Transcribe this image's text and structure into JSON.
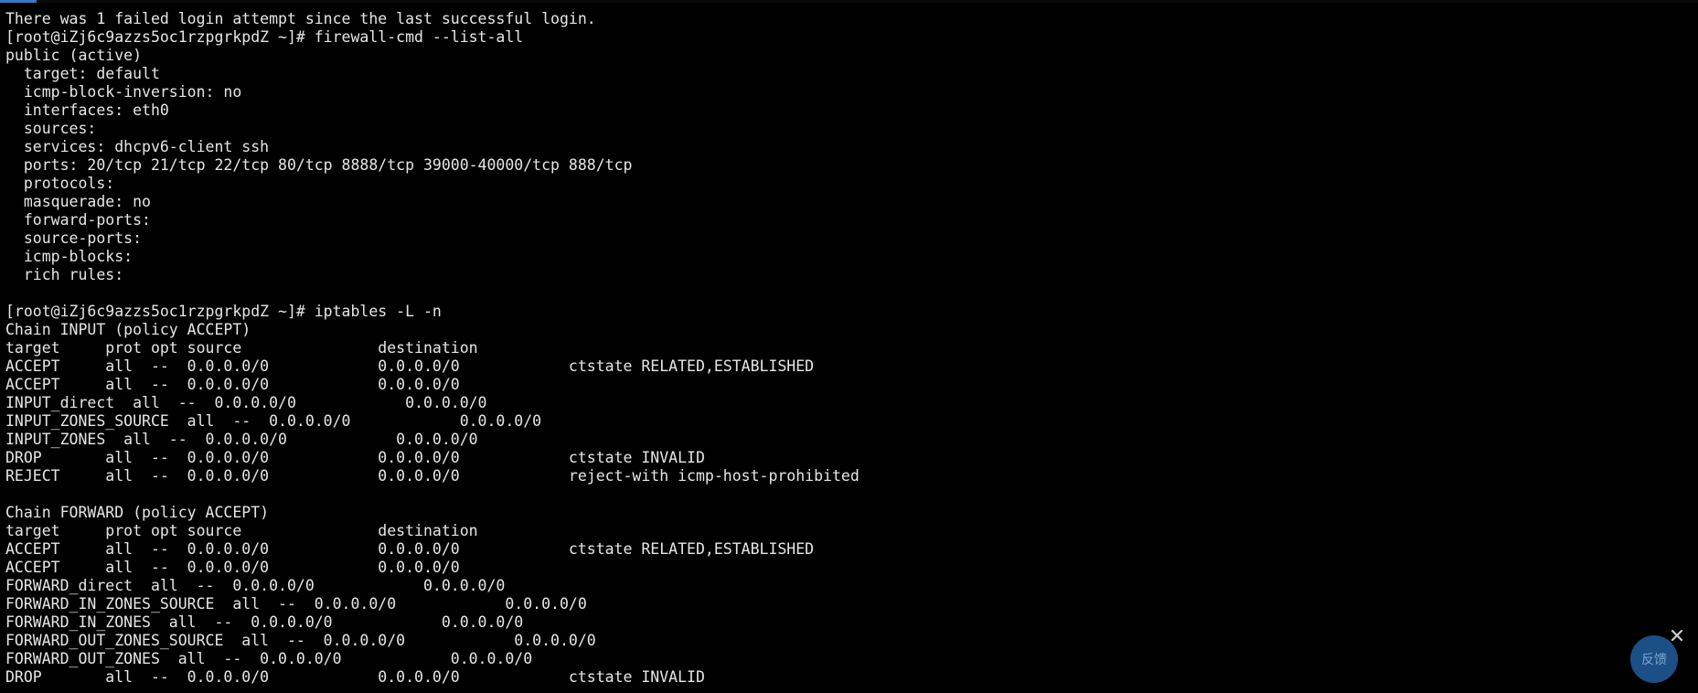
{
  "theme": {
    "background": "#000000",
    "foreground": "#e6e6e6",
    "accent": "#3b78c2",
    "feedback_bg": "#1b4f86"
  },
  "terminal": {
    "lines": [
      "There was 1 failed login attempt since the last successful login.",
      "[root@iZj6c9azzs5oc1rzpgrkpdZ ~]# firewall-cmd --list-all",
      "public (active)",
      "  target: default",
      "  icmp-block-inversion: no",
      "  interfaces: eth0",
      "  sources: ",
      "  services: dhcpv6-client ssh",
      "  ports: 20/tcp 21/tcp 22/tcp 80/tcp 8888/tcp 39000-40000/tcp 888/tcp",
      "  protocols: ",
      "  masquerade: no",
      "  forward-ports: ",
      "  source-ports: ",
      "  icmp-blocks: ",
      "  rich rules: ",
      "",
      "[root@iZj6c9azzs5oc1rzpgrkpdZ ~]# iptables -L -n",
      "Chain INPUT (policy ACCEPT)",
      "target     prot opt source               destination         ",
      "ACCEPT     all  --  0.0.0.0/0            0.0.0.0/0            ctstate RELATED,ESTABLISHED",
      "ACCEPT     all  --  0.0.0.0/0            0.0.0.0/0           ",
      "INPUT_direct  all  --  0.0.0.0/0            0.0.0.0/0           ",
      "INPUT_ZONES_SOURCE  all  --  0.0.0.0/0            0.0.0.0/0           ",
      "INPUT_ZONES  all  --  0.0.0.0/0            0.0.0.0/0           ",
      "DROP       all  --  0.0.0.0/0            0.0.0.0/0            ctstate INVALID",
      "REJECT     all  --  0.0.0.0/0            0.0.0.0/0            reject-with icmp-host-prohibited",
      "",
      "Chain FORWARD (policy ACCEPT)",
      "target     prot opt source               destination         ",
      "ACCEPT     all  --  0.0.0.0/0            0.0.0.0/0            ctstate RELATED,ESTABLISHED",
      "ACCEPT     all  --  0.0.0.0/0            0.0.0.0/0           ",
      "FORWARD_direct  all  --  0.0.0.0/0            0.0.0.0/0           ",
      "FORWARD_IN_ZONES_SOURCE  all  --  0.0.0.0/0            0.0.0.0/0           ",
      "FORWARD_IN_ZONES  all  --  0.0.0.0/0            0.0.0.0/0           ",
      "FORWARD_OUT_ZONES_SOURCE  all  --  0.0.0.0/0            0.0.0.0/0           ",
      "FORWARD_OUT_ZONES  all  --  0.0.0.0/0            0.0.0.0/0           ",
      "DROP       all  --  0.0.0.0/0            0.0.0.0/0            ctstate INVALID"
    ]
  },
  "feedback": {
    "label": "反馈",
    "close_icon": "close-icon"
  }
}
